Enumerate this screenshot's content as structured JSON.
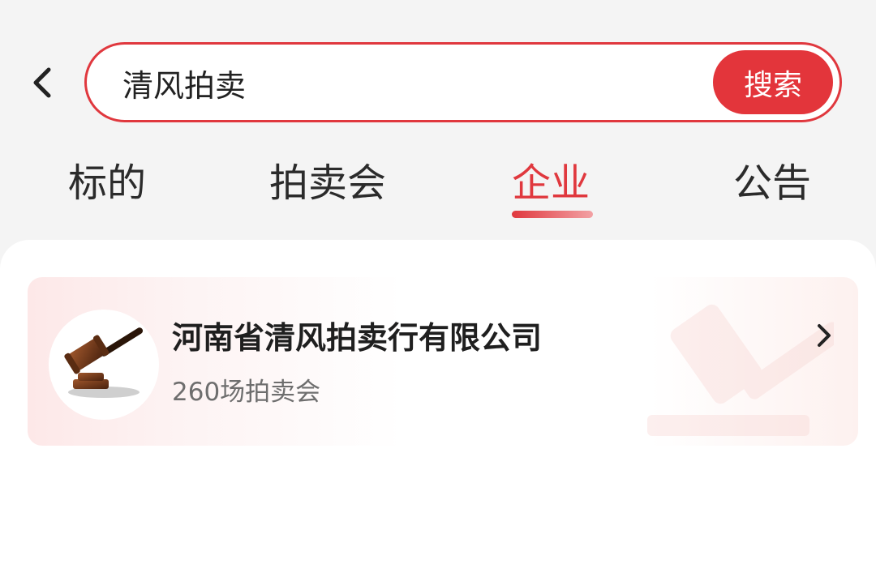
{
  "header": {
    "back_icon": "chevron-left-icon"
  },
  "search": {
    "value": "清风拍卖",
    "button_label": "搜索",
    "accent_color": "#e3353b"
  },
  "tabs": [
    {
      "label": "标的",
      "active": false
    },
    {
      "label": "拍卖会",
      "active": false
    },
    {
      "label": "企业",
      "active": true
    },
    {
      "label": "公告",
      "active": false
    }
  ],
  "results": [
    {
      "name": "河南省清风拍卖行有限公司",
      "subtitle": "260场拍卖会",
      "logo_icon": "gavel-icon",
      "action_icon": "chevron-right-icon"
    }
  ]
}
